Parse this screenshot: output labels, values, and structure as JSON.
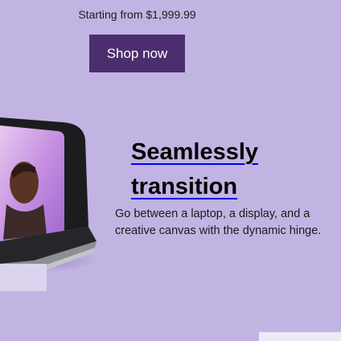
{
  "promo": {
    "price_text": "Starting from $1,999.99",
    "cta_label": "Shop now"
  },
  "feature": {
    "heading_line1": "Seamlessly",
    "heading_line2": "transition",
    "description": "Go between a laptop, a display, and a creative canvas with the dynamic hinge."
  },
  "colors": {
    "page_background": "#c1b4e2",
    "cta_background": "#4b2e6e",
    "link_underline": "#0000ee"
  },
  "images": {
    "product": "laptop-studio-product-image"
  }
}
